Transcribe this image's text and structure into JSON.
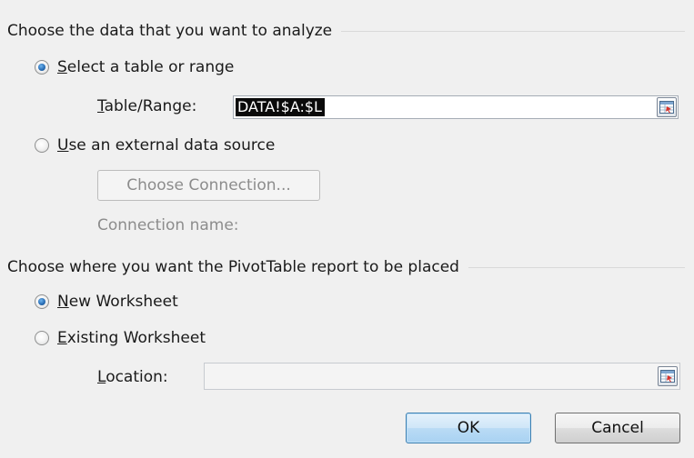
{
  "section_data": {
    "title": "Choose the data that you want to analyze",
    "options": {
      "table_range": {
        "pre": "",
        "key": "S",
        "post": "elect a table or range",
        "selected": true
      },
      "external": {
        "pre": "",
        "key": "U",
        "post": "se an external data source",
        "selected": false
      }
    },
    "table_range_label": {
      "pre": "",
      "key": "T",
      "post": "able/Range:"
    },
    "table_range_value": "DATA!$A:$L",
    "choose_connection_label": "Choose Connection...",
    "connection_name_label": "Connection name:"
  },
  "section_placement": {
    "title": "Choose where you want the PivotTable report to be placed",
    "options": {
      "new_worksheet": {
        "pre": "",
        "key": "N",
        "post": "ew Worksheet",
        "selected": true
      },
      "existing_worksheet": {
        "pre": "",
        "key": "E",
        "post": "xisting Worksheet",
        "selected": false
      }
    },
    "location_label": {
      "pre": "",
      "key": "L",
      "post": "ocation:"
    },
    "location_value": ""
  },
  "buttons": {
    "ok": "OK",
    "cancel": "Cancel"
  },
  "icons": {
    "range_collapse": "range-collapse-icon"
  },
  "colors": {
    "accent_radio": "#2a6fb7",
    "ok_border": "#3c7fb1",
    "selection_bg": "#0a0a0a"
  }
}
